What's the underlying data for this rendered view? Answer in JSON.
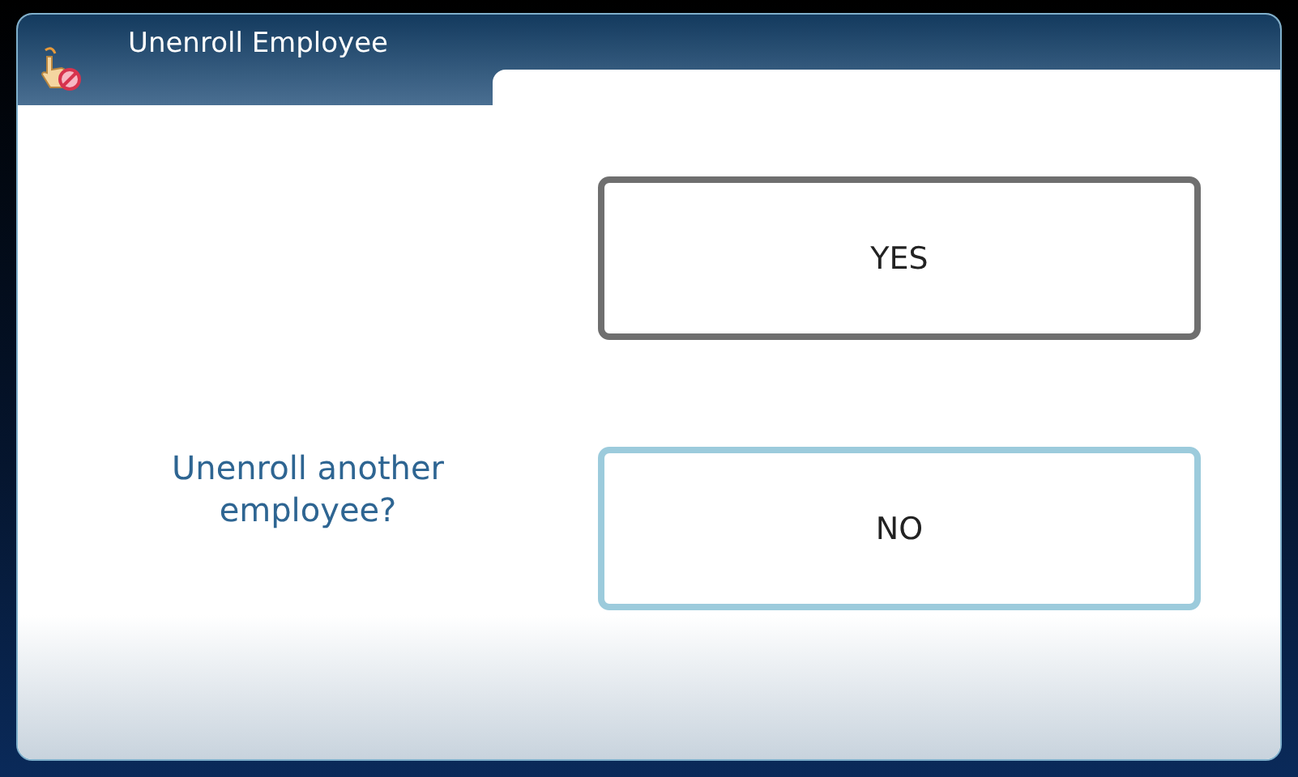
{
  "window": {
    "title": "Unenroll Employee"
  },
  "prompt": "Unenroll another employee?",
  "buttons": [
    {
      "label": "YES",
      "selected": false
    },
    {
      "label": "NO",
      "selected": true
    }
  ]
}
